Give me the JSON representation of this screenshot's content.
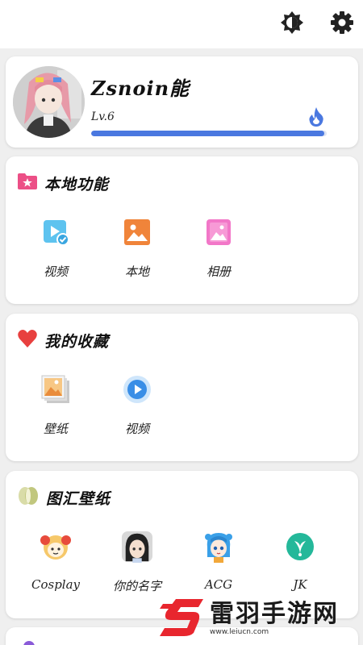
{
  "header": {
    "theme_icon": "brightness-icon",
    "settings_icon": "gear-icon"
  },
  "profile": {
    "username": "Zsnoin能",
    "level": "Lv.6",
    "level_progress": 0.99,
    "accent": "#4a78e0"
  },
  "local_features": {
    "title": "本地功能",
    "items": [
      {
        "label": "视频",
        "icon": "video-check-icon"
      },
      {
        "label": "本地",
        "icon": "image-icon"
      },
      {
        "label": "相册",
        "icon": "album-icon"
      }
    ]
  },
  "favorites": {
    "title": "我的收藏",
    "items": [
      {
        "label": "壁纸",
        "icon": "wallpaper-stack-icon"
      },
      {
        "label": "视频",
        "icon": "play-circle-icon"
      }
    ]
  },
  "gallery": {
    "title": "图汇壁纸",
    "items": [
      {
        "label": "Cosplay",
        "icon": "cosplay-avatar-icon"
      },
      {
        "label": "你的名字",
        "icon": "your-name-avatar-icon"
      },
      {
        "label": "ACG",
        "icon": "acg-avatar-icon"
      },
      {
        "label": "JK",
        "icon": "jk-logo-icon"
      }
    ]
  },
  "watermark": {
    "text": "雷羽手游网",
    "url": "www.leiucn.com"
  }
}
